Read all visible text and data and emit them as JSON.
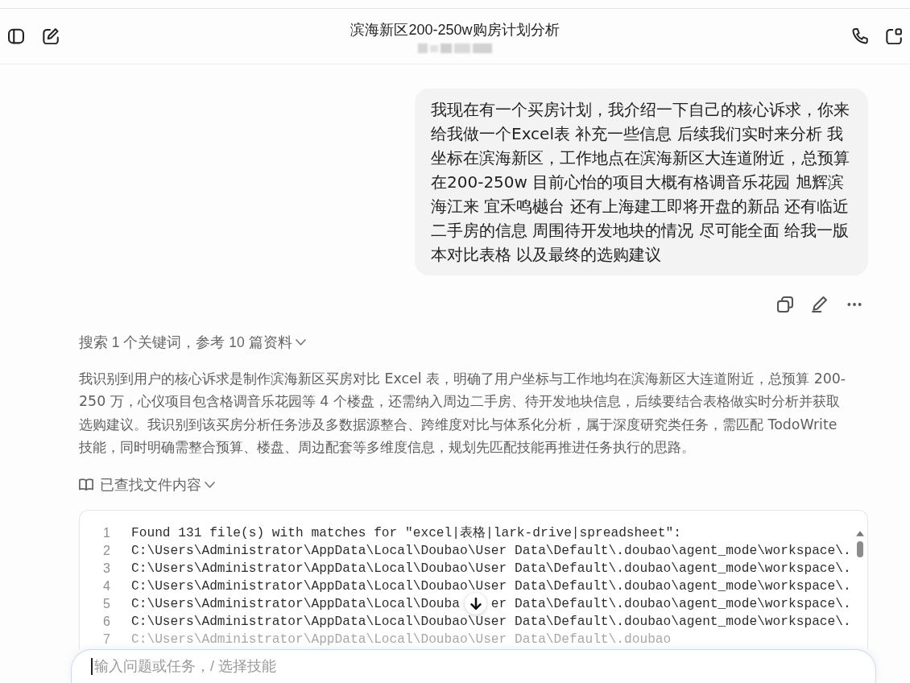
{
  "header": {
    "title": "滨海新区200-250w购房计划分析"
  },
  "user_message": {
    "text": "我现在有一个买房计划，我介绍一下自己的核心诉求，你来给我做一个Excel表 补充一些信息 后续我们实时来分析 我坐标在滨海新区，工作地点在滨海新区大连道附近，总预算在200-250w 目前心怡的项目大概有格调音乐花园 旭辉滨海江来 宜禾鸣樾台 还有上海建工即将开盘的新品 还有临近二手房的信息 周围待开发地块的情况 尽可能全面 给我一版本对比表格 以及最终的选购建议"
  },
  "assistant": {
    "search_summary": "搜索 1 个关键词，参考 10 篇资料",
    "reasoning": "我识别到用户的核心诉求是制作滨海新区买房对比 Excel 表，明确了用户坐标与工作地均在滨海新区大连道附近，总预算 200-250 万，心仪项目包含格调音乐花园等 4 个楼盘，还需纳入周边二手房、待开发地块信息，后续要结合表格做实时分析并获取选购建议。我识别到该买房分析任务涉及多数据源整合、跨维度对比与体系化分析，属于深度研究类任务，需匹配 TodoWrite 技能，同时明确需整合预算、楼盘、周边配套等多维度信息，规划先匹配技能再推进任务执行的思路。",
    "file_search_label": "已查找文件内容",
    "code_output": {
      "lines": [
        {
          "number": "1",
          "segments": [
            "Found 131 file(s) with matches for \"excel|表格|lark-drive|spreadsheet\":"
          ]
        },
        {
          "number": "2",
          "segments": [
            "C:\\Users\\Administrator\\AppData\\Local\\Doubao\\User Data\\Default\\.doubao\\agent_mode\\workspace\\."
          ]
        },
        {
          "number": "3",
          "segments": [
            "C:\\Users\\Administrator\\AppData\\Local\\Doubao\\User Data\\Default\\.doubao\\agent_mode\\workspace\\."
          ]
        },
        {
          "number": "4",
          "segments": [
            "C:\\Users\\Administrator\\AppData\\Local\\Doubao\\User Data\\Default\\.doubao\\agent_mode\\workspace\\."
          ]
        },
        {
          "number": "5",
          "segments": [
            "C:\\Users\\Administrator\\AppData\\Local\\Douba",
            "er Data\\Default\\.doubao\\agent_mode\\workspace\\."
          ]
        },
        {
          "number": "6",
          "segments": [
            "C:\\Users\\Administrator\\AppData\\Local\\Doubao\\User Data\\Default\\.doubao\\agent_mode\\workspace\\."
          ]
        },
        {
          "number": "7",
          "segments": [
            "C:\\Users\\Administrator\\AppData\\Local\\Doubao\\User Data\\Default\\.doubao"
          ]
        }
      ]
    }
  },
  "input": {
    "placeholder": "输入问题或任务，/ 选择技能"
  }
}
